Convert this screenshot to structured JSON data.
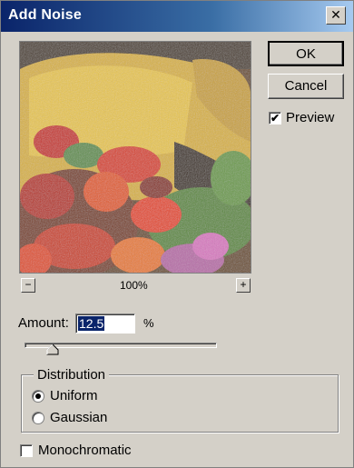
{
  "dialog": {
    "title": "Add Noise",
    "close_glyph": "✕"
  },
  "buttons": {
    "ok_label": "OK",
    "cancel_label": "Cancel"
  },
  "preview": {
    "checkbox_label": "Preview",
    "checked": true,
    "zoom_level": "100%",
    "zoom_out_glyph": "−",
    "zoom_in_glyph": "+"
  },
  "amount": {
    "label": "Amount:",
    "value": "12.5",
    "unit": "%"
  },
  "distribution": {
    "legend": "Distribution",
    "options": [
      {
        "label": "Uniform",
        "selected": true
      },
      {
        "label": "Gaussian",
        "selected": false
      }
    ]
  },
  "monochromatic": {
    "label": "Monochromatic",
    "checked": false
  },
  "colors": {
    "titlebar": "#0a246a",
    "dialog_bg": "#d4d0c8",
    "selection": "#0a246a"
  }
}
